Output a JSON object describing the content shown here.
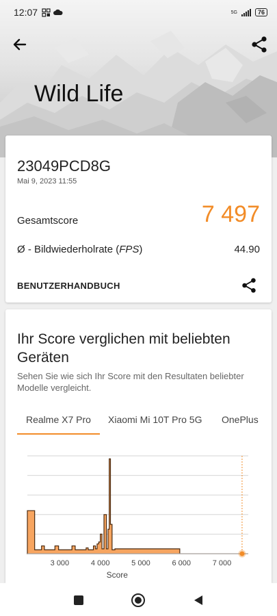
{
  "status_bar": {
    "time": "12:07",
    "battery": "76",
    "network": "5G"
  },
  "header": {
    "title": "Wild Life",
    "back_icon": "arrow-left-icon",
    "share_icon": "share-icon"
  },
  "result": {
    "device": "23049PCD8G",
    "date": "Mai 9, 2023 11:55",
    "score_label": "Gesamtscore",
    "score_value": "7 497",
    "fps_label_prefix": "Ø - Bildwiederholrate (",
    "fps_label_italic": "FPS",
    "fps_label_suffix": ")",
    "fps_value": "44.90",
    "manual_label": "BENUTZERHANDBUCH"
  },
  "compare": {
    "title": "Ihr Score verglichen mit beliebten Geräten",
    "subtitle": "Sehen Sie wie sich Ihr Score mit den Resultaten beliebter Modelle vergleicht.",
    "tabs": [
      "Realme X7 Pro",
      "Xiaomi Mi 10T Pro 5G",
      "OnePlus"
    ],
    "active_tab": 0
  },
  "chart_data": {
    "type": "area",
    "xlabel": "Score",
    "x_ticks": [
      "3 000",
      "4 000",
      "5 000",
      "6 000",
      "7 000"
    ],
    "x_tick_values": [
      3000,
      4000,
      5000,
      6000,
      7000
    ],
    "xlim": [
      2200,
      7650
    ],
    "ylim": [
      0,
      1
    ],
    "grid": true,
    "marker_value": 7497,
    "fill_color": "#f7a560",
    "line_color": "#4a2a10",
    "marker_color": "#f28c28",
    "distribution": [
      [
        2200,
        0
      ],
      [
        2200,
        0.44
      ],
      [
        2380,
        0.44
      ],
      [
        2380,
        0.04
      ],
      [
        2550,
        0.04
      ],
      [
        2550,
        0.08
      ],
      [
        2620,
        0.08
      ],
      [
        2620,
        0.04
      ],
      [
        2880,
        0.04
      ],
      [
        2880,
        0.08
      ],
      [
        2970,
        0.08
      ],
      [
        2970,
        0.04
      ],
      [
        3300,
        0.04
      ],
      [
        3300,
        0.08
      ],
      [
        3380,
        0.08
      ],
      [
        3380,
        0.04
      ],
      [
        3650,
        0.04
      ],
      [
        3650,
        0.06
      ],
      [
        3700,
        0.06
      ],
      [
        3700,
        0.04
      ],
      [
        3830,
        0.04
      ],
      [
        3830,
        0.08
      ],
      [
        3880,
        0.08
      ],
      [
        3880,
        0.05
      ],
      [
        3920,
        0.05
      ],
      [
        3920,
        0.1
      ],
      [
        3960,
        0.1
      ],
      [
        3960,
        0.12
      ],
      [
        4000,
        0.12
      ],
      [
        4000,
        0.2
      ],
      [
        4040,
        0.2
      ],
      [
        4040,
        0.05
      ],
      [
        4090,
        0.05
      ],
      [
        4090,
        0.4
      ],
      [
        4150,
        0.4
      ],
      [
        4150,
        0.05
      ],
      [
        4190,
        0.05
      ],
      [
        4190,
        0.25
      ],
      [
        4220,
        0.25
      ],
      [
        4220,
        0.97
      ],
      [
        4250,
        0.97
      ],
      [
        4250,
        0.3
      ],
      [
        4290,
        0.3
      ],
      [
        4290,
        0.04
      ],
      [
        4360,
        0.04
      ],
      [
        4360,
        0.05
      ],
      [
        5960,
        0.05
      ],
      [
        5960,
        0
      ],
      [
        7650,
        0
      ]
    ]
  },
  "nav": {
    "recent_icon": "square-icon",
    "home_icon": "circle-home-icon",
    "back_icon": "triangle-back-icon"
  },
  "colors": {
    "accent": "#f28c28",
    "text": "#222222"
  }
}
